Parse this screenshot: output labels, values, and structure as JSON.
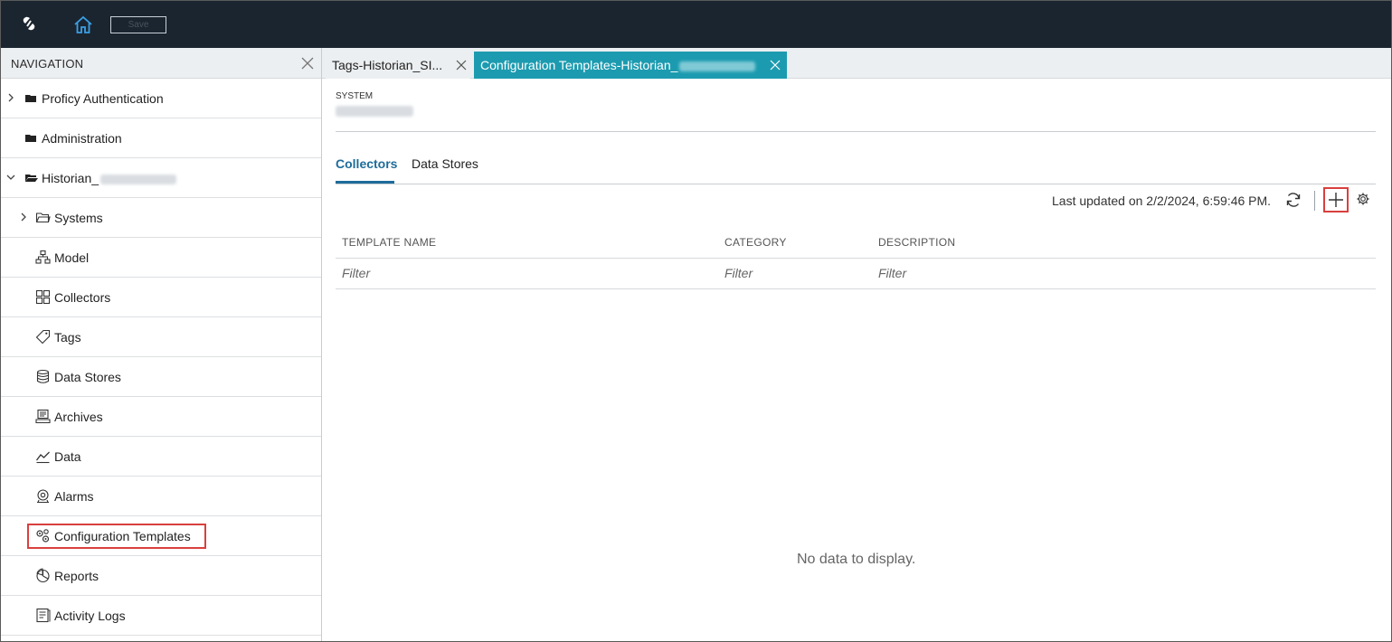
{
  "toolbar": {
    "save_label": "Save"
  },
  "navigation": {
    "title": "NAVIGATION",
    "items": [
      {
        "label": "Proficy Authentication",
        "icon": "folder-icon",
        "expander": "right"
      },
      {
        "label": "Administration",
        "icon": "folder-icon",
        "expander": "none"
      },
      {
        "label": "Historian_",
        "icon": "folder-open-icon",
        "expander": "down"
      },
      {
        "label": "Systems",
        "icon": "folder-outline-icon",
        "expander": "right"
      },
      {
        "label": "Model",
        "icon": "hierarchy-icon"
      },
      {
        "label": "Collectors",
        "icon": "grid-icon"
      },
      {
        "label": "Tags",
        "icon": "tag-icon"
      },
      {
        "label": "Data Stores",
        "icon": "database-icon"
      },
      {
        "label": "Archives",
        "icon": "archive-icon"
      },
      {
        "label": "Data",
        "icon": "line-chart-icon"
      },
      {
        "label": "Alarms",
        "icon": "alarm-icon"
      },
      {
        "label": "Configuration Templates",
        "icon": "gears-icon"
      },
      {
        "label": "Reports",
        "icon": "pie-chart-icon"
      },
      {
        "label": "Activity Logs",
        "icon": "log-icon"
      }
    ]
  },
  "tabs": [
    {
      "label": "Tags-Historian_SI..."
    },
    {
      "label": "Configuration Templates-Historian_"
    }
  ],
  "main": {
    "system_label": "SYSTEM",
    "subtabs": [
      "Collectors",
      "Data Stores"
    ],
    "last_updated": "Last updated on 2/2/2024, 6:59:46 PM.",
    "columns": [
      "TEMPLATE NAME",
      "CATEGORY",
      "DESCRIPTION"
    ],
    "filter_placeholder": "Filter",
    "empty_message": "No data to display."
  },
  "colors": {
    "topbar": "#1b2530",
    "active_tab": "#1c9bb0",
    "accent": "#1e6c9a",
    "highlight": "#d9403e"
  }
}
